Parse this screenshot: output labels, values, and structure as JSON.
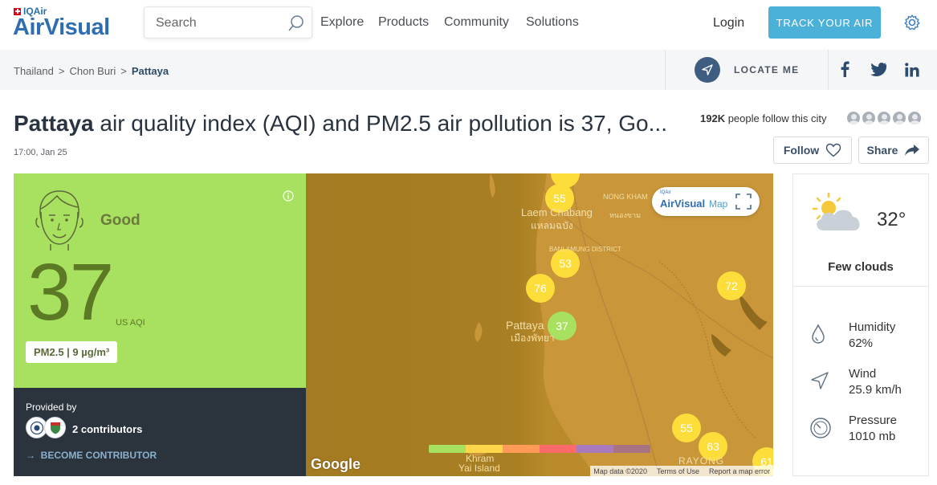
{
  "header": {
    "logo_top": "IQAir",
    "logo_main": "AirVisual",
    "search_placeholder": "Search",
    "nav": [
      "Explore",
      "Products",
      "Community",
      "Solutions"
    ],
    "login": "Login",
    "track_button": "TRACK YOUR AIR",
    "accent_color": "#4bb1d8"
  },
  "breadcrumb": {
    "items": [
      "Thailand",
      "Chon Buri"
    ],
    "current": "Pattaya",
    "separator": ">",
    "locate_me": "LOCATE ME",
    "social_icons": [
      "facebook-icon",
      "twitter-icon",
      "linkedin-icon"
    ]
  },
  "page": {
    "city": "Pattaya",
    "title_rest": " air quality index (AQI) and PM2.5 air pollution is 37, Go...",
    "date": "17:00, Jan 25",
    "followers_count": "192K",
    "followers_text": "people follow this city",
    "follow_button": "Follow",
    "share_button": "Share"
  },
  "aqi": {
    "status": "Good",
    "value": "37",
    "unit": "US AQI",
    "pm": "PM2.5 | 9 µg/m³",
    "color": "#a8e05f",
    "provided_by": "Provided by",
    "contributors": "2 contributors",
    "become": "BECOME CONTRIBUTOR"
  },
  "map": {
    "markers": [
      {
        "value": "55"
      },
      {
        "value": "53"
      },
      {
        "value": "76"
      },
      {
        "value": "72"
      },
      {
        "value": "37"
      },
      {
        "value": "55"
      },
      {
        "value": "63"
      },
      {
        "value": "61"
      }
    ],
    "labels": [
      "Laem Chabang",
      "แหลมฉบัง",
      "Pattaya",
      "เมืองพัทยา",
      "NONG KHAM",
      "หนองขาม",
      "BANLAMUNG DISTRICT",
      "Khram",
      "Yai Island",
      "RAYONG"
    ],
    "badge_small": "IQAir",
    "badge_brand": "AirVisual",
    "badge_map": "Map",
    "google": "Google",
    "footer": [
      "Map data ©2020",
      "Terms of Use",
      "Report a map error"
    ],
    "legend_colors": [
      "#a8e05f",
      "#fdd64b",
      "#ff9b57",
      "#fe6a69",
      "#a97abc",
      "#a87383"
    ]
  },
  "weather": {
    "temperature": "32°",
    "condition": "Few clouds",
    "humidity_label": "Humidity",
    "humidity_value": "62%",
    "wind_label": "Wind",
    "wind_value": "25.9 km/h",
    "pressure_label": "Pressure",
    "pressure_value": "1010 mb"
  }
}
